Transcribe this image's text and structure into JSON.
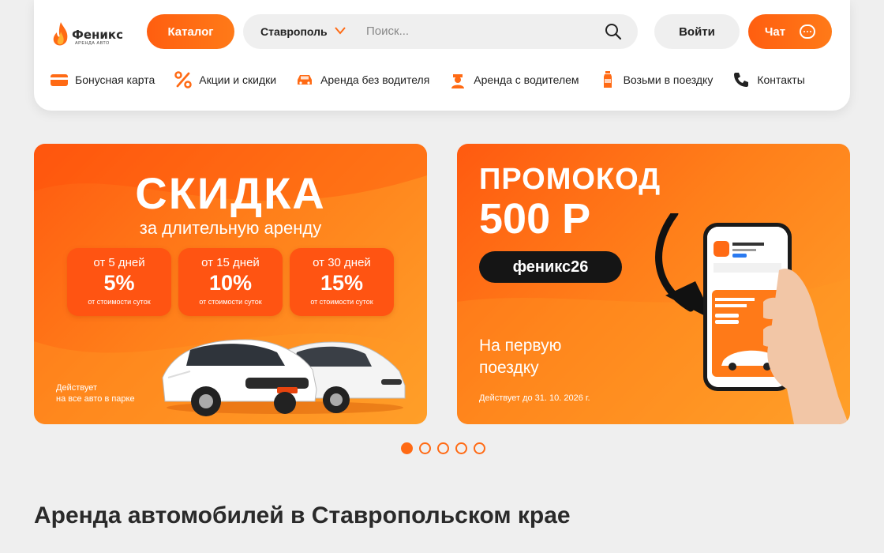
{
  "header": {
    "logo_name": "Феникс",
    "logo_sub": "АРЕНДА АВТО",
    "catalog_label": "Каталог",
    "city": "Ставрополь",
    "search_placeholder": "Поиск...",
    "login_label": "Войти",
    "chat_label": "Чат",
    "accent_color": "#ff6a14"
  },
  "nav": [
    {
      "label": "Бонусная карта",
      "icon": "card-icon"
    },
    {
      "label": "Акции и скидки",
      "icon": "percent-icon"
    },
    {
      "label": "Аренда без водителя",
      "icon": "car-icon"
    },
    {
      "label": "Аренда с водителем",
      "icon": "driver-icon"
    },
    {
      "label": "Возьми в поездку",
      "icon": "bottle-icon"
    },
    {
      "label": "Контакты",
      "icon": "phone-icon"
    }
  ],
  "banner1": {
    "title": "СКИДКА",
    "subtitle": "за длительную аренду",
    "discounts": [
      {
        "days": "от 5 дней",
        "pct": "5%",
        "note": "от стоимости суток"
      },
      {
        "days": "от 15 дней",
        "pct": "10%",
        "note": "от стоимости суток"
      },
      {
        "days": "от 30 дней",
        "pct": "15%",
        "note": "от стоимости суток"
      }
    ],
    "note_line1": "Действует",
    "note_line2": "на все авто в парке"
  },
  "banner2": {
    "title": "ПРОМОКОД",
    "amount": "500 Р",
    "code": "феникс26",
    "sub_line1": "На первую",
    "sub_line2": "поездку",
    "note": "Действует до 31. 10. 2026 г."
  },
  "carousel": {
    "total": 5,
    "active": 1
  },
  "section_title": "Аренда автомобилей в Ставропольском крае"
}
